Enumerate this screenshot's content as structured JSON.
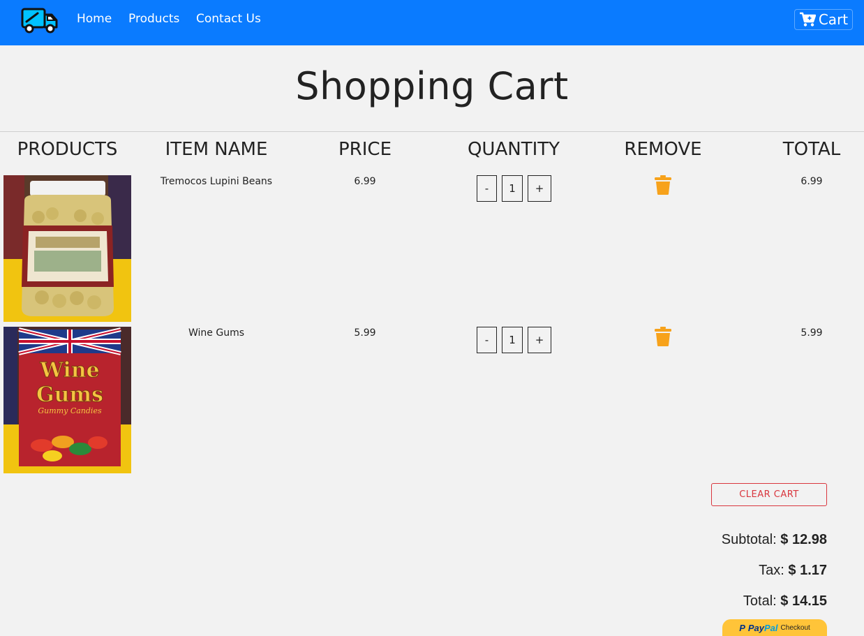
{
  "navbar": {
    "logo_icon": "delivery-truck-icon",
    "links": [
      "Home",
      "Products",
      "Contact Us"
    ],
    "cart_label": "Cart",
    "cart_icon": "shopping-cart-icon",
    "background": "#0a7bff"
  },
  "page": {
    "title": "Shopping Cart"
  },
  "table": {
    "headers": [
      "PRODUCTS",
      "ITEM NAME",
      "PRICE",
      "QUANTITY",
      "REMOVE",
      "TOTAL"
    ],
    "rows": [
      {
        "image": "Tremocos Lupini Beans jar",
        "name": "Tremocos Lupini Beans",
        "price": "6.99",
        "quantity": "1",
        "decrement": "-",
        "increment": "+",
        "remove_icon": "trash-icon",
        "total": "6.99"
      },
      {
        "image": "Wine Gums box",
        "name": "Wine Gums",
        "price": "5.99",
        "quantity": "1",
        "decrement": "-",
        "increment": "+",
        "remove_icon": "trash-icon",
        "total": "5.99"
      }
    ]
  },
  "summary": {
    "clear_cart": "CLEAR CART",
    "subtotal_label": "Subtotal:",
    "subtotal_value": "$ 12.98",
    "tax_label": "Tax:",
    "tax_value": "$ 1.17",
    "total_label": "Total:",
    "total_value": "$ 14.15",
    "paypal_pay": "Pay",
    "paypal_pal": "Pal",
    "paypal_checkout": "Checkout"
  },
  "colors": {
    "trash": "#f7a21b",
    "clear_cart": "#d9363e",
    "paypal": "#ffc439"
  }
}
